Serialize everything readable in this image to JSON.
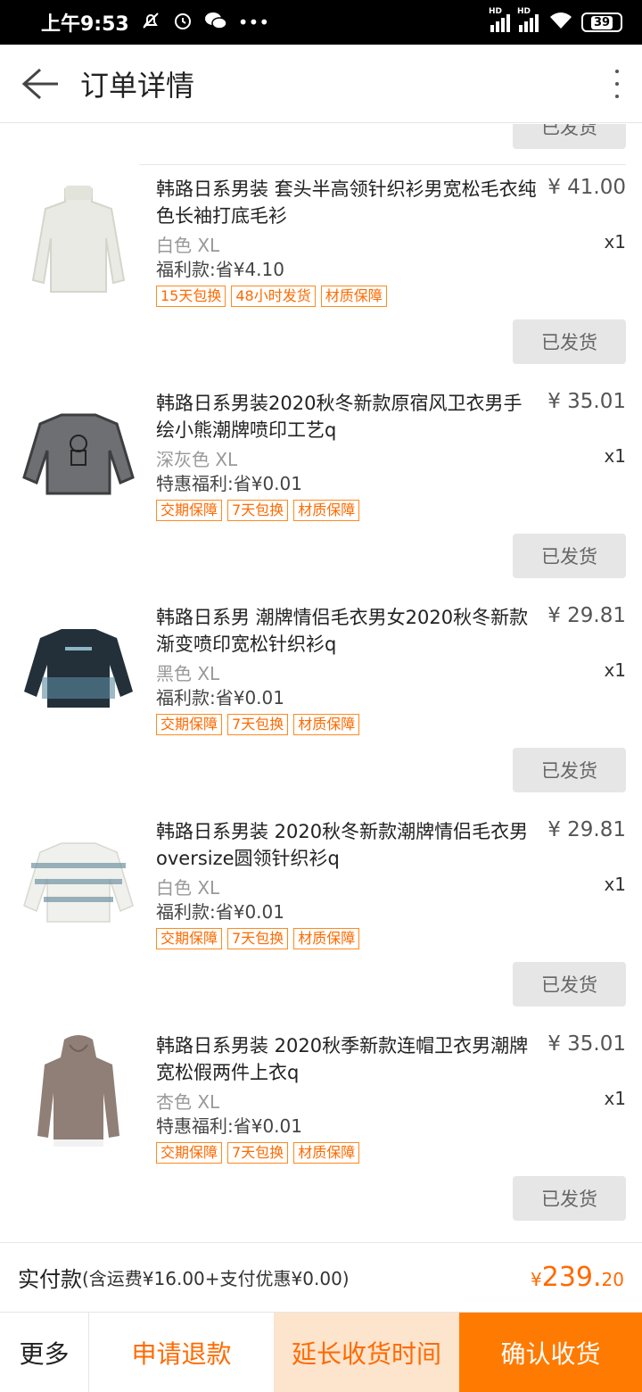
{
  "status_bar": {
    "time": "上午9:53",
    "icons": [
      "no-disturb-icon",
      "alarm-icon",
      "wechat-icon",
      "more-notifications-icon"
    ],
    "network": "HD",
    "battery": "39"
  },
  "header": {
    "title": "订单详情",
    "back_icon": "arrow-left-icon",
    "menu_icon": "vertical-dots-icon"
  },
  "shipped_label": "已发货",
  "items": [
    {
      "name": "韩路日系男装 套头半高领针织衫男宽松毛衣纯色长袖打底毛衫",
      "price": "¥ 41.00",
      "spec": "白色 XL",
      "qty": "x1",
      "discount": "福利款:省¥4.10",
      "tags": [
        "15天包换",
        "48小时发货",
        "材质保障"
      ],
      "image": "white-turtleneck-sweater",
      "colors": {
        "body": "#e9eae3",
        "accent": "#d4d6cc"
      }
    },
    {
      "name": "韩路日系男装2020秋冬新款原宿风卫衣男手绘小熊潮牌喷印工艺q",
      "price": "¥ 35.01",
      "spec": "深灰色 XL",
      "qty": "x1",
      "discount": "特惠福利:省¥0.01",
      "tags": [
        "交期保障",
        "7天包换",
        "材质保障"
      ],
      "image": "gray-bear-sweatshirt",
      "colors": {
        "body": "#6e6f72",
        "accent": "#3d3e40"
      }
    },
    {
      "name": "韩路日系男 潮牌情侣毛衣男女2020秋冬新款渐变喷印宽松针织衫q",
      "price": "¥ 29.81",
      "spec": "黑色 XL",
      "qty": "x1",
      "discount": "福利款:省¥0.01",
      "tags": [
        "交期保障",
        "7天包换",
        "材质保障"
      ],
      "image": "black-gradient-sweater",
      "colors": {
        "body": "#23303a",
        "accent": "#5b8aa0"
      }
    },
    {
      "name": "韩路日系男装 2020秋冬新款潮牌情侣毛衣男oversize圆领针织衫q",
      "price": "¥ 29.81",
      "spec": "白色 XL",
      "qty": "x1",
      "discount": "福利款:省¥0.01",
      "tags": [
        "交期保障",
        "7天包换",
        "材质保障"
      ],
      "image": "white-tiedye-sweater",
      "colors": {
        "body": "#f0f0ec",
        "accent": "#6f93a3"
      }
    },
    {
      "name": "韩路日系男装 2020秋季新款连帽卫衣男潮牌宽松假两件上衣q",
      "price": "¥ 35.01",
      "spec": "杏色 XL",
      "qty": "x1",
      "discount": "特惠福利:省¥0.01",
      "tags": [
        "交期保障",
        "7天包换",
        "材质保障"
      ],
      "image": "apricot-hoodie",
      "colors": {
        "body": "#8f7f77",
        "accent": "#f2f2f2"
      }
    }
  ],
  "total": {
    "label": "实付款",
    "detail": "(含运费¥16.00+支付优惠¥0.00)",
    "currency": "¥",
    "integer": "239.",
    "decimal": "20"
  },
  "actions": {
    "more": "更多",
    "refund": "申请退款",
    "extend": "延长收货时间",
    "confirm": "确认收货"
  },
  "theme": {
    "accent": "#ff6a00"
  }
}
